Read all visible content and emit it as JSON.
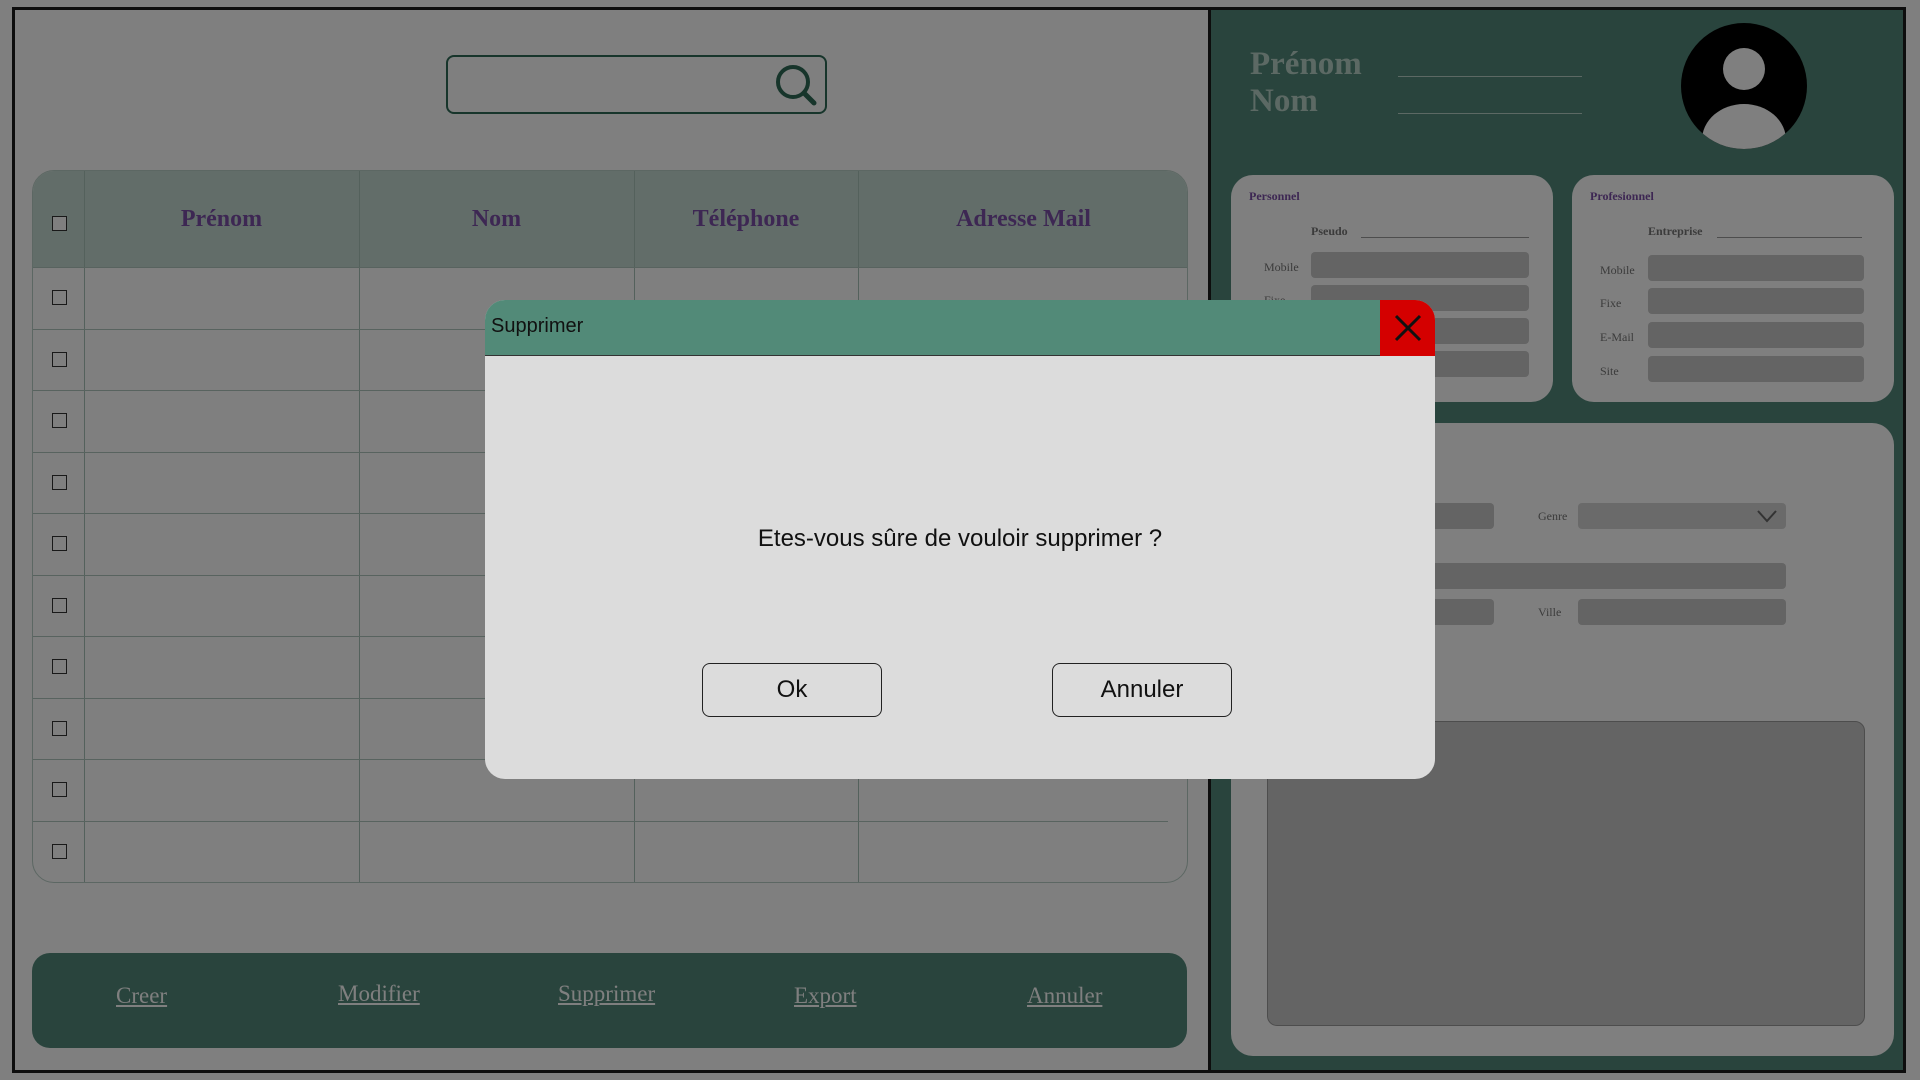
{
  "dialog": {
    "title": "Supprimer",
    "message": "Etes-vous sûre de vouloir supprimer ?",
    "ok_label": "Ok",
    "cancel_label": "Annuler",
    "close_icon": "close-icon"
  },
  "table": {
    "columns": [
      "Prénom",
      "Nom",
      "Téléphone",
      "Adresse Mail"
    ]
  },
  "actions": {
    "create": "Creer",
    "modify": "Modifier",
    "delete": "Supprimer",
    "export": "Export",
    "cancel": "Annuler"
  },
  "contact": {
    "first_name_label": "Prénom",
    "last_name_label": "Nom"
  },
  "personal": {
    "title": "Personnel",
    "pseudo_label": "Pseudo",
    "mobile_label": "Mobile",
    "fixe_label": "Fixe"
  },
  "professional": {
    "title": "Profesionnel",
    "company_label": "Entreprise",
    "mobile_label": "Mobile",
    "fixe_label": "Fixe",
    "email_label": "E-Mail",
    "site_label": "Site"
  },
  "details": {
    "genre_label": "Genre",
    "ville_label": "Ville"
  },
  "colors": {
    "accent": "#52897a",
    "header_row": "#c4dbd2",
    "label_purple": "#7b4fa6",
    "close_red": "#d40000"
  }
}
